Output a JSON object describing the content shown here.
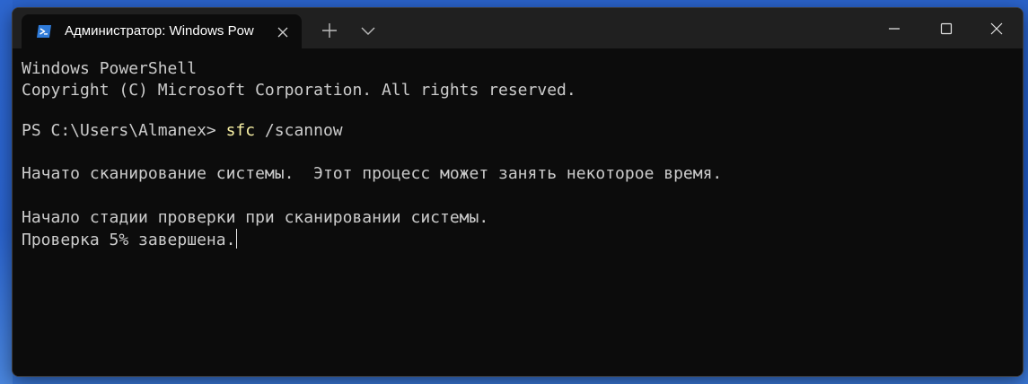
{
  "window": {
    "tab_title": "Администратор: Windows Pow",
    "tab_icon": "powershell-icon",
    "new_tab_icon": "plus-icon",
    "dropdown_icon": "chevron-down-icon",
    "minimize_icon": "minimize-icon",
    "maximize_icon": "maximize-icon",
    "close_icon": "close-icon"
  },
  "terminal": {
    "header_line1": "Windows PowerShell",
    "header_line2": "Copyright (C) Microsoft Corporation. All rights reserved.",
    "prompt": "PS C:\\Users\\Almanex> ",
    "command": "sfc",
    "command_args": " /scannow",
    "output_line1": "Начато сканирование системы.  Этот процесс может занять некоторое время.",
    "output_line2": "Начало стадии проверки при сканировании системы.",
    "output_line3": "Проверка 5% завершена."
  },
  "colors": {
    "terminal_background": "#0c0c0c",
    "terminal_text": "#cccccc",
    "command_highlight": "#f9f1a5",
    "titlebar": "#202020",
    "desktop": "#2a62c9"
  }
}
